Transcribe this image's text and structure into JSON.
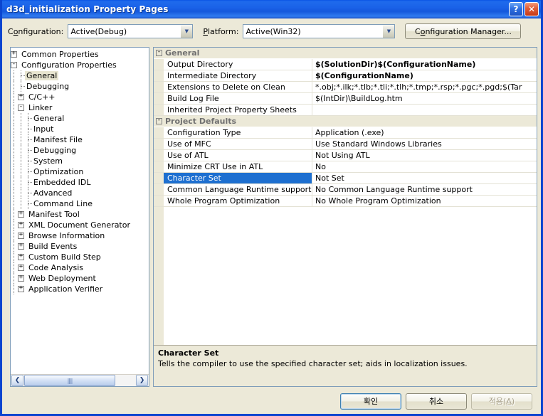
{
  "window": {
    "title": "d3d_initialization Property Pages",
    "help_button": "?",
    "close_button": "✕"
  },
  "configbar": {
    "configuration_label_pre": "C",
    "configuration_label_accel": "o",
    "configuration_label_post": "nfiguration:",
    "configuration_value": "Active(Debug)",
    "platform_label_pre": "",
    "platform_label_accel": "P",
    "platform_label_post": "latform:",
    "platform_value": "Active(Win32)",
    "config_manager_pre": "C",
    "config_manager_accel": "o",
    "config_manager_post": "nfiguration Manager...",
    "arrow_glyph": "▼"
  },
  "tree": {
    "items": [
      {
        "label": "Common Properties",
        "indent": 0,
        "expander": "+",
        "selected": false
      },
      {
        "label": "Configuration Properties",
        "indent": 0,
        "expander": "-",
        "selected": false
      },
      {
        "label": "General",
        "indent": 1,
        "expander": "leaf",
        "selected": true
      },
      {
        "label": "Debugging",
        "indent": 1,
        "expander": "leaf",
        "selected": false
      },
      {
        "label": "C/C++",
        "indent": 1,
        "expander": "+",
        "selected": false
      },
      {
        "label": "Linker",
        "indent": 1,
        "expander": "-",
        "selected": false
      },
      {
        "label": "General",
        "indent": 2,
        "expander": "leaf",
        "selected": false
      },
      {
        "label": "Input",
        "indent": 2,
        "expander": "leaf",
        "selected": false
      },
      {
        "label": "Manifest File",
        "indent": 2,
        "expander": "leaf",
        "selected": false
      },
      {
        "label": "Debugging",
        "indent": 2,
        "expander": "leaf",
        "selected": false
      },
      {
        "label": "System",
        "indent": 2,
        "expander": "leaf",
        "selected": false
      },
      {
        "label": "Optimization",
        "indent": 2,
        "expander": "leaf",
        "selected": false
      },
      {
        "label": "Embedded IDL",
        "indent": 2,
        "expander": "leaf",
        "selected": false
      },
      {
        "label": "Advanced",
        "indent": 2,
        "expander": "leaf",
        "selected": false
      },
      {
        "label": "Command Line",
        "indent": 2,
        "expander": "leaf",
        "selected": false
      },
      {
        "label": "Manifest Tool",
        "indent": 1,
        "expander": "+",
        "selected": false
      },
      {
        "label": "XML Document Generator",
        "indent": 1,
        "expander": "+",
        "selected": false
      },
      {
        "label": "Browse Information",
        "indent": 1,
        "expander": "+",
        "selected": false
      },
      {
        "label": "Build Events",
        "indent": 1,
        "expander": "+",
        "selected": false
      },
      {
        "label": "Custom Build Step",
        "indent": 1,
        "expander": "+",
        "selected": false
      },
      {
        "label": "Code Analysis",
        "indent": 1,
        "expander": "+",
        "selected": false
      },
      {
        "label": "Web Deployment",
        "indent": 1,
        "expander": "+",
        "selected": false
      },
      {
        "label": "Application Verifier",
        "indent": 1,
        "expander": "+",
        "selected": false
      }
    ],
    "scroll_left_glyph": "❮",
    "scroll_right_glyph": "❯",
    "thumb_grip": "||||"
  },
  "grid": {
    "sections": [
      {
        "title": "General",
        "expander": "-",
        "rows": [
          {
            "name": "Output Directory",
            "value": "$(SolutionDir)$(ConfigurationName)",
            "bold": true,
            "selected": false,
            "dropdown": false
          },
          {
            "name": "Intermediate Directory",
            "value": "$(ConfigurationName)",
            "bold": true,
            "selected": false,
            "dropdown": false
          },
          {
            "name": "Extensions to Delete on Clean",
            "value": "*.obj;*.ilk;*.tlb;*.tli;*.tlh;*.tmp;*.rsp;*.pgc;*.pgd;$(Tar",
            "bold": false,
            "selected": false,
            "dropdown": false
          },
          {
            "name": "Build Log File",
            "value": "$(IntDir)\\BuildLog.htm",
            "bold": false,
            "selected": false,
            "dropdown": false
          },
          {
            "name": "Inherited Project Property Sheets",
            "value": "",
            "bold": false,
            "selected": false,
            "dropdown": false
          }
        ]
      },
      {
        "title": "Project Defaults",
        "expander": "-",
        "rows": [
          {
            "name": "Configuration Type",
            "value": "Application (.exe)",
            "bold": false,
            "selected": false,
            "dropdown": false
          },
          {
            "name": "Use of MFC",
            "value": "Use Standard Windows Libraries",
            "bold": false,
            "selected": false,
            "dropdown": false
          },
          {
            "name": "Use of ATL",
            "value": "Not Using ATL",
            "bold": false,
            "selected": false,
            "dropdown": false
          },
          {
            "name": "Minimize CRT Use in ATL",
            "value": "No",
            "bold": false,
            "selected": false,
            "dropdown": false
          },
          {
            "name": "Character Set",
            "value": "Not Set",
            "bold": false,
            "selected": true,
            "dropdown": true
          },
          {
            "name": "Common Language Runtime support",
            "value": "No Common Language Runtime support",
            "bold": false,
            "selected": false,
            "dropdown": false
          },
          {
            "name": "Whole Program Optimization",
            "value": "No Whole Program Optimization",
            "bold": false,
            "selected": false,
            "dropdown": false
          }
        ]
      }
    ],
    "dropdown_glyph": "▼"
  },
  "description": {
    "title": "Character Set",
    "text": "Tells the compiler to use the specified character set; aids in localization issues."
  },
  "footer": {
    "ok_label": "확인",
    "cancel_label": "취소",
    "apply_pre": "적용(",
    "apply_accel": "A",
    "apply_post": ")"
  },
  "colors": {
    "titlebar_blue": "#1A62E8",
    "frame_blue": "#0A45D0",
    "dialog_bg": "#ECE9D8",
    "selection_blue": "#1D6FD0",
    "tree_selection": "#E8E5D0",
    "category_text": "#707070"
  }
}
